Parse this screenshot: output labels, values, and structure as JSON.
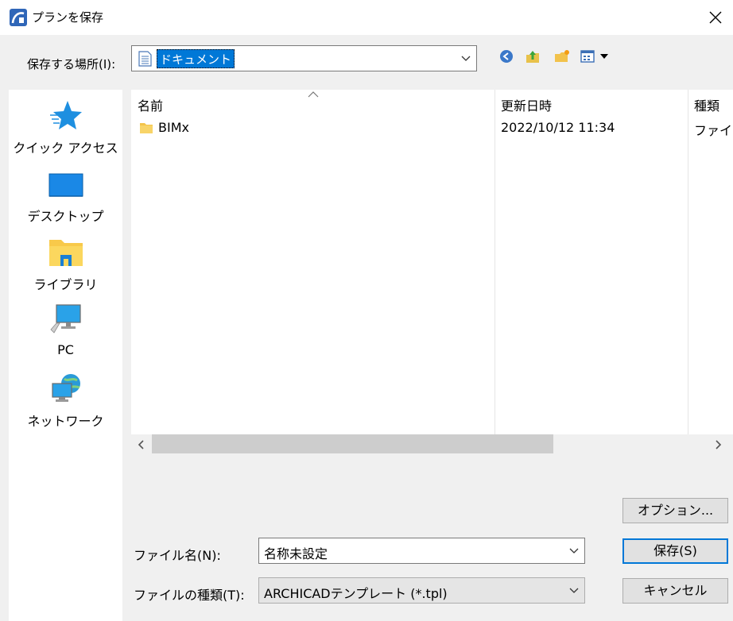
{
  "window": {
    "title": "プランを保存",
    "close_label": "閉じる"
  },
  "location": {
    "label": "保存する場所(I):",
    "value": "ドキュメント"
  },
  "places": [
    {
      "label": "クイック アクセス"
    },
    {
      "label": "デスクトップ"
    },
    {
      "label": "ライブラリ"
    },
    {
      "label": "PC"
    },
    {
      "label": "ネットワーク"
    }
  ],
  "columns": {
    "name": "名前",
    "date": "更新日時",
    "type": "種類"
  },
  "files": [
    {
      "name": "BIMx",
      "date": "2022/10/12 11:34",
      "type": "ファイル"
    }
  ],
  "options_label": "オプション...",
  "filename": {
    "label": "ファイル名(N):",
    "value": "名称未設定"
  },
  "filetype": {
    "label": "ファイルの種類(T):",
    "value": "ARCHICADテンプレート (*.tpl)"
  },
  "save_label": "保存(S)",
  "cancel_label": "キャンセル"
}
